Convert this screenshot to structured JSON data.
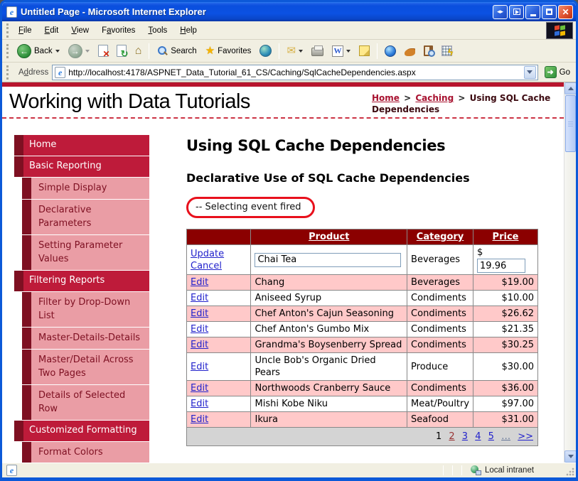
{
  "window": {
    "title": "Untitled Page - Microsoft Internet Explorer"
  },
  "menu": {
    "items": [
      {
        "pre": "",
        "accel": "F",
        "post": "ile"
      },
      {
        "pre": "",
        "accel": "E",
        "post": "dit"
      },
      {
        "pre": "",
        "accel": "V",
        "post": "iew"
      },
      {
        "pre": "F",
        "accel": "a",
        "post": "vorites"
      },
      {
        "pre": "",
        "accel": "T",
        "post": "ools"
      },
      {
        "pre": "",
        "accel": "H",
        "post": "elp"
      }
    ]
  },
  "toolbar": {
    "back": "Back",
    "search": "Search",
    "favorites": "Favorites",
    "word": "W"
  },
  "address": {
    "label": {
      "pre": "A",
      "accel": "d",
      "post": "dress"
    },
    "url": "http://localhost:4178/ASPNET_Data_Tutorial_61_CS/Caching/SqlCacheDependencies.aspx",
    "go": "Go"
  },
  "page": {
    "site_title": "Working with Data Tutorials",
    "breadcrumb": {
      "home": "Home",
      "section": "Caching",
      "current": "Using SQL Cache Dependencies",
      "separator": ">"
    },
    "sidebar": [
      {
        "label": "Home",
        "type": "top"
      },
      {
        "label": "Basic Reporting",
        "type": "top"
      },
      {
        "label": "Simple Display",
        "type": "sub"
      },
      {
        "label": "Declarative Parameters",
        "type": "sub"
      },
      {
        "label": "Setting Parameter Values",
        "type": "sub"
      },
      {
        "label": "Filtering Reports",
        "type": "top"
      },
      {
        "label": "Filter by Drop-Down List",
        "type": "sub"
      },
      {
        "label": "Master-Details-Details",
        "type": "sub"
      },
      {
        "label": "Master/Detail Across Two Pages",
        "type": "sub"
      },
      {
        "label": "Details of Selected Row",
        "type": "sub"
      },
      {
        "label": "Customized Formatting",
        "type": "top"
      },
      {
        "label": "Format Colors",
        "type": "sub"
      }
    ],
    "main": {
      "title": "Using SQL Cache Dependencies",
      "subtitle": "Declarative Use of SQL Cache Dependencies",
      "event_message": "-- Selecting event fired",
      "table": {
        "headers": {
          "product": "Product",
          "category": "Category",
          "price": "Price"
        },
        "edit_label": "Edit",
        "edit_row": {
          "update": "Update",
          "cancel": "Cancel",
          "product": "Chai Tea",
          "category": "Beverages",
          "currency": "$",
          "price": "19.96"
        },
        "rows": [
          {
            "product": "Chang",
            "category": "Beverages",
            "price": "$19.00"
          },
          {
            "product": "Aniseed Syrup",
            "category": "Condiments",
            "price": "$10.00"
          },
          {
            "product": "Chef Anton's Cajun Seasoning",
            "category": "Condiments",
            "price": "$26.62"
          },
          {
            "product": "Chef Anton's Gumbo Mix",
            "category": "Condiments",
            "price": "$21.35"
          },
          {
            "product": "Grandma's Boysenberry Spread",
            "category": "Condiments",
            "price": "$30.25"
          },
          {
            "product": "Uncle Bob's Organic Dried Pears",
            "category": "Produce",
            "price": "$30.00"
          },
          {
            "product": "Northwoods Cranberry Sauce",
            "category": "Condiments",
            "price": "$36.00"
          },
          {
            "product": "Mishi Kobe Niku",
            "category": "Meat/Poultry",
            "price": "$97.00"
          },
          {
            "product": "Ikura",
            "category": "Seafood",
            "price": "$31.00"
          }
        ],
        "pager": [
          "1",
          "2",
          "3",
          "4",
          "5",
          "…",
          ">>"
        ]
      }
    }
  },
  "statusbar": {
    "zone": "Local intranet"
  },
  "colors": {
    "titlebar_blue": "#0A4FDE",
    "window_border": "#0C59D8",
    "nav_crimson": "#BE1B3A",
    "nav_maroon": "#7E1022",
    "nav_pink": "#EA9DA5",
    "table_header_maroon": "#8B0000",
    "table_row_pink": "#FFC9C9",
    "pager_gray": "#D4D4D4",
    "link_blue": "#2222CC",
    "visited_red": "#993333",
    "breadcrumb_link_red": "#A81230",
    "annotation_red": "#E8101C",
    "top_stripe_red": "#B8152E",
    "chrome_beige": "#F1EFE2"
  }
}
